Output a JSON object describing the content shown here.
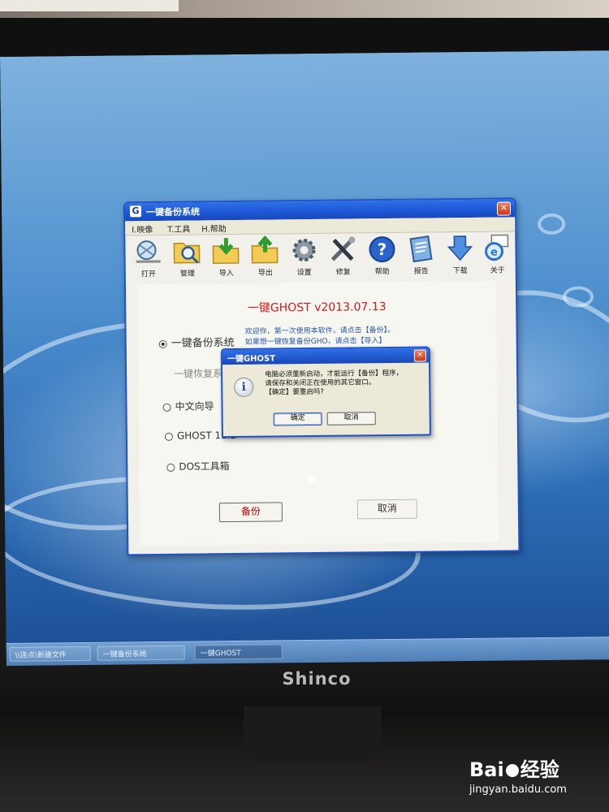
{
  "monitor": {
    "brand": "Shinco"
  },
  "window": {
    "title": "一键备份系统",
    "icon_letter": "G",
    "close": "✕",
    "menu": [
      "I.映像",
      "T.工具",
      "H.帮助"
    ]
  },
  "toolbar": [
    {
      "label": "打开",
      "icon": "open-icon"
    },
    {
      "label": "管理",
      "icon": "manage-icon"
    },
    {
      "label": "导入",
      "icon": "import-icon"
    },
    {
      "label": "导出",
      "icon": "export-icon"
    },
    {
      "label": "设置",
      "icon": "settings-gear-icon"
    },
    {
      "label": "修复",
      "icon": "repair-tools-icon"
    },
    {
      "label": "帮助",
      "icon": "help-icon"
    },
    {
      "label": "报告",
      "icon": "report-icon"
    },
    {
      "label": "下载",
      "icon": "download-icon"
    },
    {
      "label": "关于",
      "icon": "about-ie-icon"
    }
  ],
  "content": {
    "app_title": "一键GHOST v2013.07.13",
    "options": {
      "backup": "一键备份系统",
      "restore": "一键恢复系",
      "cn_wizard": "中文向导",
      "ghost": "GHOST 11.2",
      "dos_tools": "DOS工具箱"
    },
    "welcome_line1": "欢迎你，第一次使用本软件，请点击【备份】。",
    "welcome_line2": "如果想一键恢复备份GHO，请点击【导入】",
    "backup_button": "备份",
    "cancel_button": "取消"
  },
  "dialog": {
    "title": "一键GHOST",
    "close": "✕",
    "info_glyph": "i",
    "message_line1": "电脑必须重新启动，才能运行【备份】程序，",
    "message_line2": "请保存和关闭正在使用的其它窗口。",
    "message_line3": "【确定】要重启吗?",
    "ok_button": "确定",
    "cancel_button": "取消"
  },
  "taskbar": {
    "items": [
      "\\\\连点\\新建文件",
      "一键备份系统",
      "一键GHOST"
    ]
  },
  "watermark": {
    "main_left": "Bai",
    "main_right": "经验",
    "sub": "jingyan.baidu.com"
  }
}
